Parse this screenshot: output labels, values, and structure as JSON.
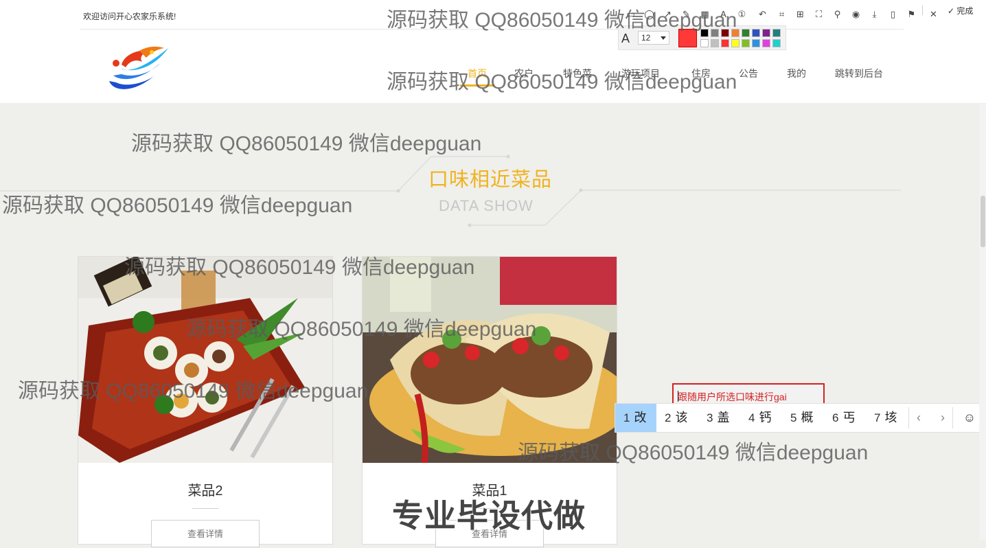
{
  "header": {
    "welcome": "欢迎访问开心农家乐系统!",
    "nav": [
      "首页",
      "农户",
      "特色菜",
      "游玩项目",
      "住房",
      "公告",
      "我的",
      "跳转到后台"
    ],
    "active_nav": "首页"
  },
  "section": {
    "title": "口味相近菜品",
    "subtitle": "DATA SHOW"
  },
  "cards": [
    {
      "name": "菜品2",
      "button": "查看详情",
      "image": "sushi-photo"
    },
    {
      "name": "菜品1",
      "button": "查看详情",
      "image": "taco-photo"
    }
  ],
  "screenshot_tool": {
    "done_label": "完成",
    "font_size": "12",
    "current_color": "#ff3838",
    "palette": [
      "#000000",
      "#808080",
      "#800000",
      "#f08030",
      "#308030",
      "#3050c0",
      "#802090",
      "#208080",
      "#ffffff",
      "#c0c0c0",
      "#ff3030",
      "#ffff20",
      "#80c020",
      "#3090e0",
      "#e040e0",
      "#20d0d0"
    ],
    "text_box": "跟随用户所选口味进行gai"
  },
  "ime": {
    "candidates": [
      {
        "num": "1",
        "char": "改"
      },
      {
        "num": "2",
        "char": "该"
      },
      {
        "num": "3",
        "char": "盖"
      },
      {
        "num": "4",
        "char": "钙"
      },
      {
        "num": "5",
        "char": "概"
      },
      {
        "num": "6",
        "char": "丐"
      },
      {
        "num": "7",
        "char": "垓"
      }
    ],
    "prev": "‹",
    "next": "›",
    "emoji": "☺"
  },
  "watermark": "源码获取 QQ86050149 微信deepguan",
  "watermark_big": "专业毕设代做",
  "colors": {
    "accent": "#f0b31f",
    "annotation_red": "#d52121"
  }
}
